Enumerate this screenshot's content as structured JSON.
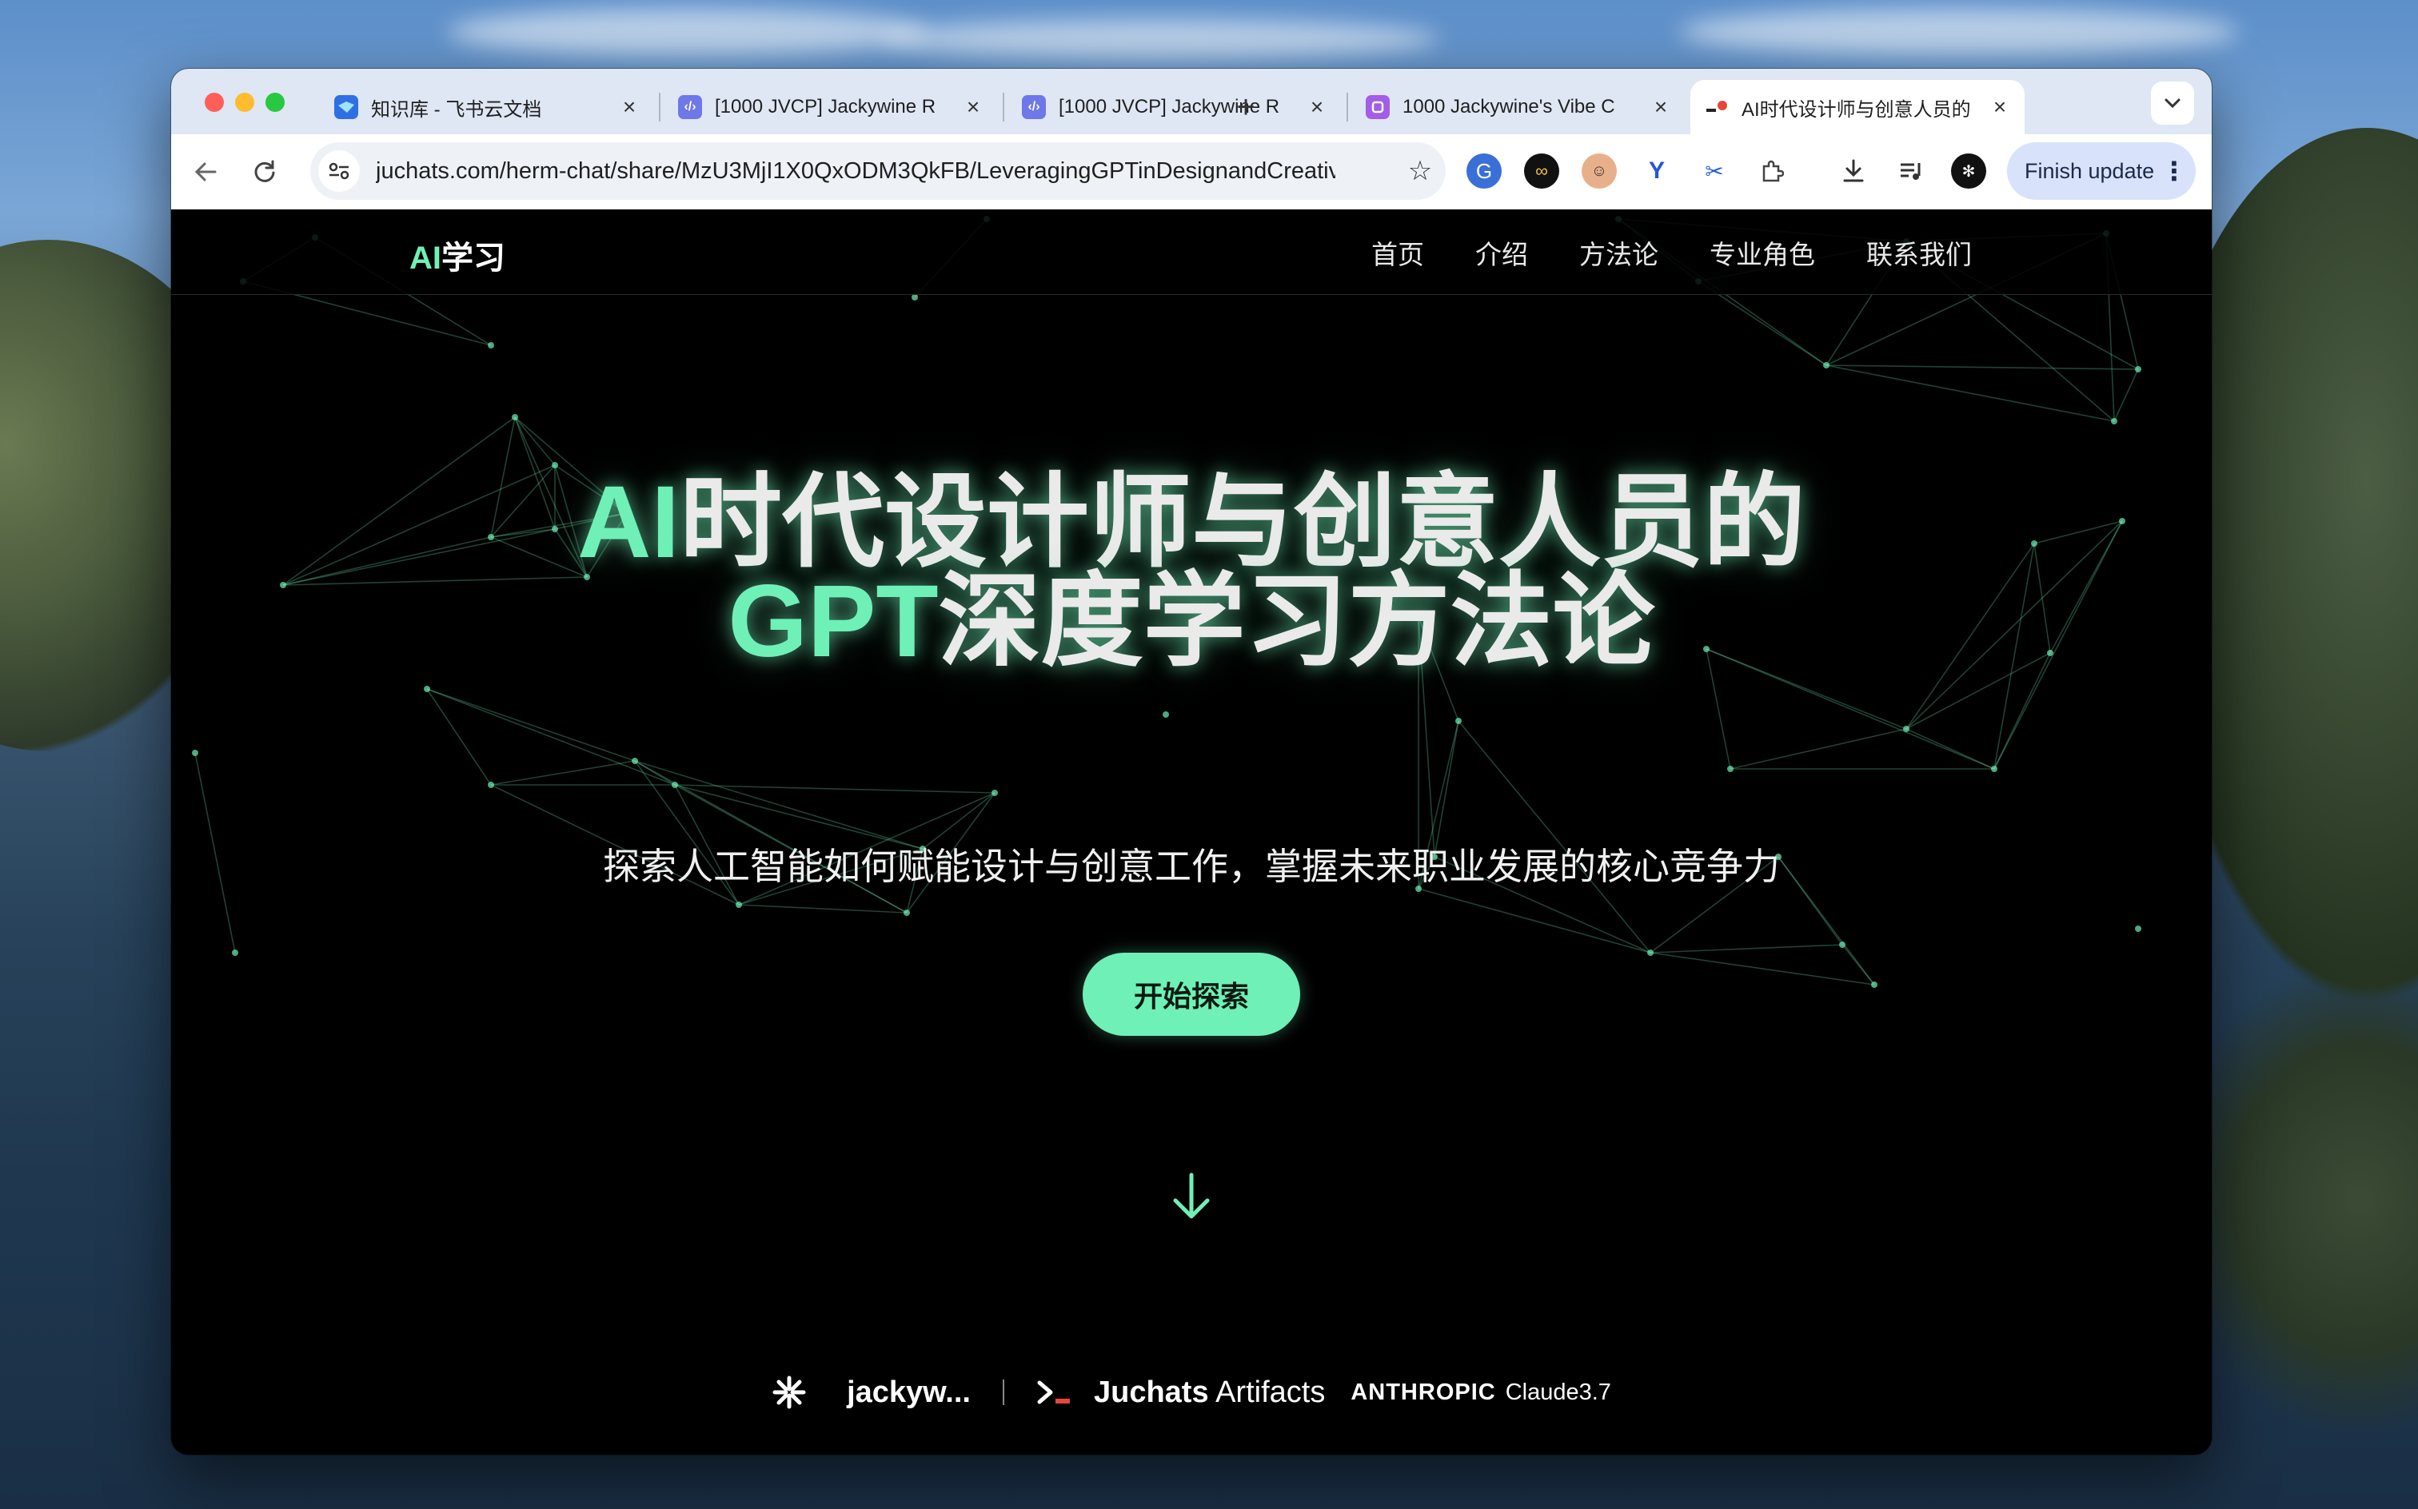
{
  "browser": {
    "tabs": [
      {
        "title": "知识库 - 飞书云文档",
        "favicon": "feishu-icon",
        "active": false
      },
      {
        "title": "[1000 JVCP] Jackywine R",
        "favicon": "code-icon",
        "active": false
      },
      {
        "title": "[1000 JVCP] Jackywine R",
        "favicon": "code-icon",
        "active": false
      },
      {
        "title": "1000 Jackywine's Vibe C",
        "favicon": "app-icon",
        "active": false
      },
      {
        "title": "AI时代设计师与创意人员的",
        "favicon": "juchats-icon",
        "active": true
      }
    ],
    "close_glyph": "×",
    "new_tab_glyph": "+",
    "tab_menu_glyph": "⌄",
    "url": "juchats.com/herm-chat/share/MzU3MjI1X0QxODM3QkFB/LeveragingGPTinDesignandCreativ...",
    "finish_update_label": "Finish update"
  },
  "site": {
    "logo_accent": "AI",
    "logo_rest": "学习",
    "nav": [
      "首页",
      "介绍",
      "方法论",
      "专业角色",
      "联系我们"
    ],
    "hero": {
      "title_line1_accent": "AI",
      "title_line1_rest": "时代设计师与创意人员的",
      "title_line2_accent": "GPT",
      "title_line2_rest": "深度学习方法论",
      "subtitle": "探索人工智能如何赋能设计与创意工作，掌握未来职业发展的核心竞争力",
      "cta": "开始探索"
    },
    "footer": {
      "user": "jackyw...",
      "terminal_prompt": ">_",
      "juchats_bold": "Juchats",
      "juchats_rest": " Artifacts",
      "anthropic": "ANTHROPIC",
      "model": "Claude3.7"
    }
  },
  "colors": {
    "accent": "#6ff0b7",
    "background": "#000000",
    "tabbar": "#dfe6f4",
    "update_button": "#d8e2fb"
  }
}
